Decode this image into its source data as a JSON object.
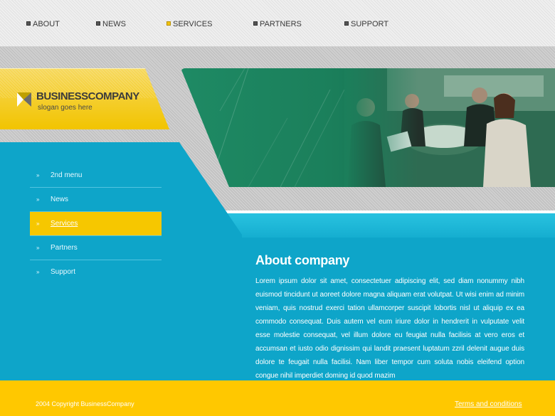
{
  "nav": {
    "items": [
      {
        "label": "ABOUT"
      },
      {
        "label": "NEWS"
      },
      {
        "label": "SERVICES"
      },
      {
        "label": "PARTNERS"
      },
      {
        "label": "SUPPORT"
      }
    ]
  },
  "logo": {
    "name": "BUSINESSCOMPANY",
    "slogan": "slogan goes here"
  },
  "menu": {
    "items": [
      {
        "label": "2nd menu"
      },
      {
        "label": "News"
      },
      {
        "label": "Services"
      },
      {
        "label": "Partners"
      },
      {
        "label": "Support"
      }
    ],
    "arrow": "»"
  },
  "content": {
    "title": "About company",
    "body": "Lorem ipsum dolor sit amet, consectetuer adipiscing elit, sed diam nonummy nibh euismod tincidunt ut aoreet dolore magna aliquam erat volutpat. Ut wisi enim ad minim veniam, quis nostrud exerci tation ullamcorper suscipit lobortis nisl ut aliquip ex ea commodo consequat. Duis autem vel eum iriure dolor in hendrerit in vulputate velit esse molestie consequat, vel illum dolore eu feugiat nulla facilisis at vero eros et accumsan et iusto odio dignissim qui landit praesent luptatum zzril delenit augue duis dolore te feugait nulla facilisi. Nam liber tempor cum soluta nobis eleifend option congue nihil imperdiet doming id quod mazim"
  },
  "footer": {
    "copyright": "2004 Copyright BusinessCompany",
    "terms": "Terms and conditions"
  },
  "colors": {
    "accent_yellow": "#ffc800",
    "primary_blue": "#0ea5c9",
    "banner_green": "#1b7f5b"
  }
}
